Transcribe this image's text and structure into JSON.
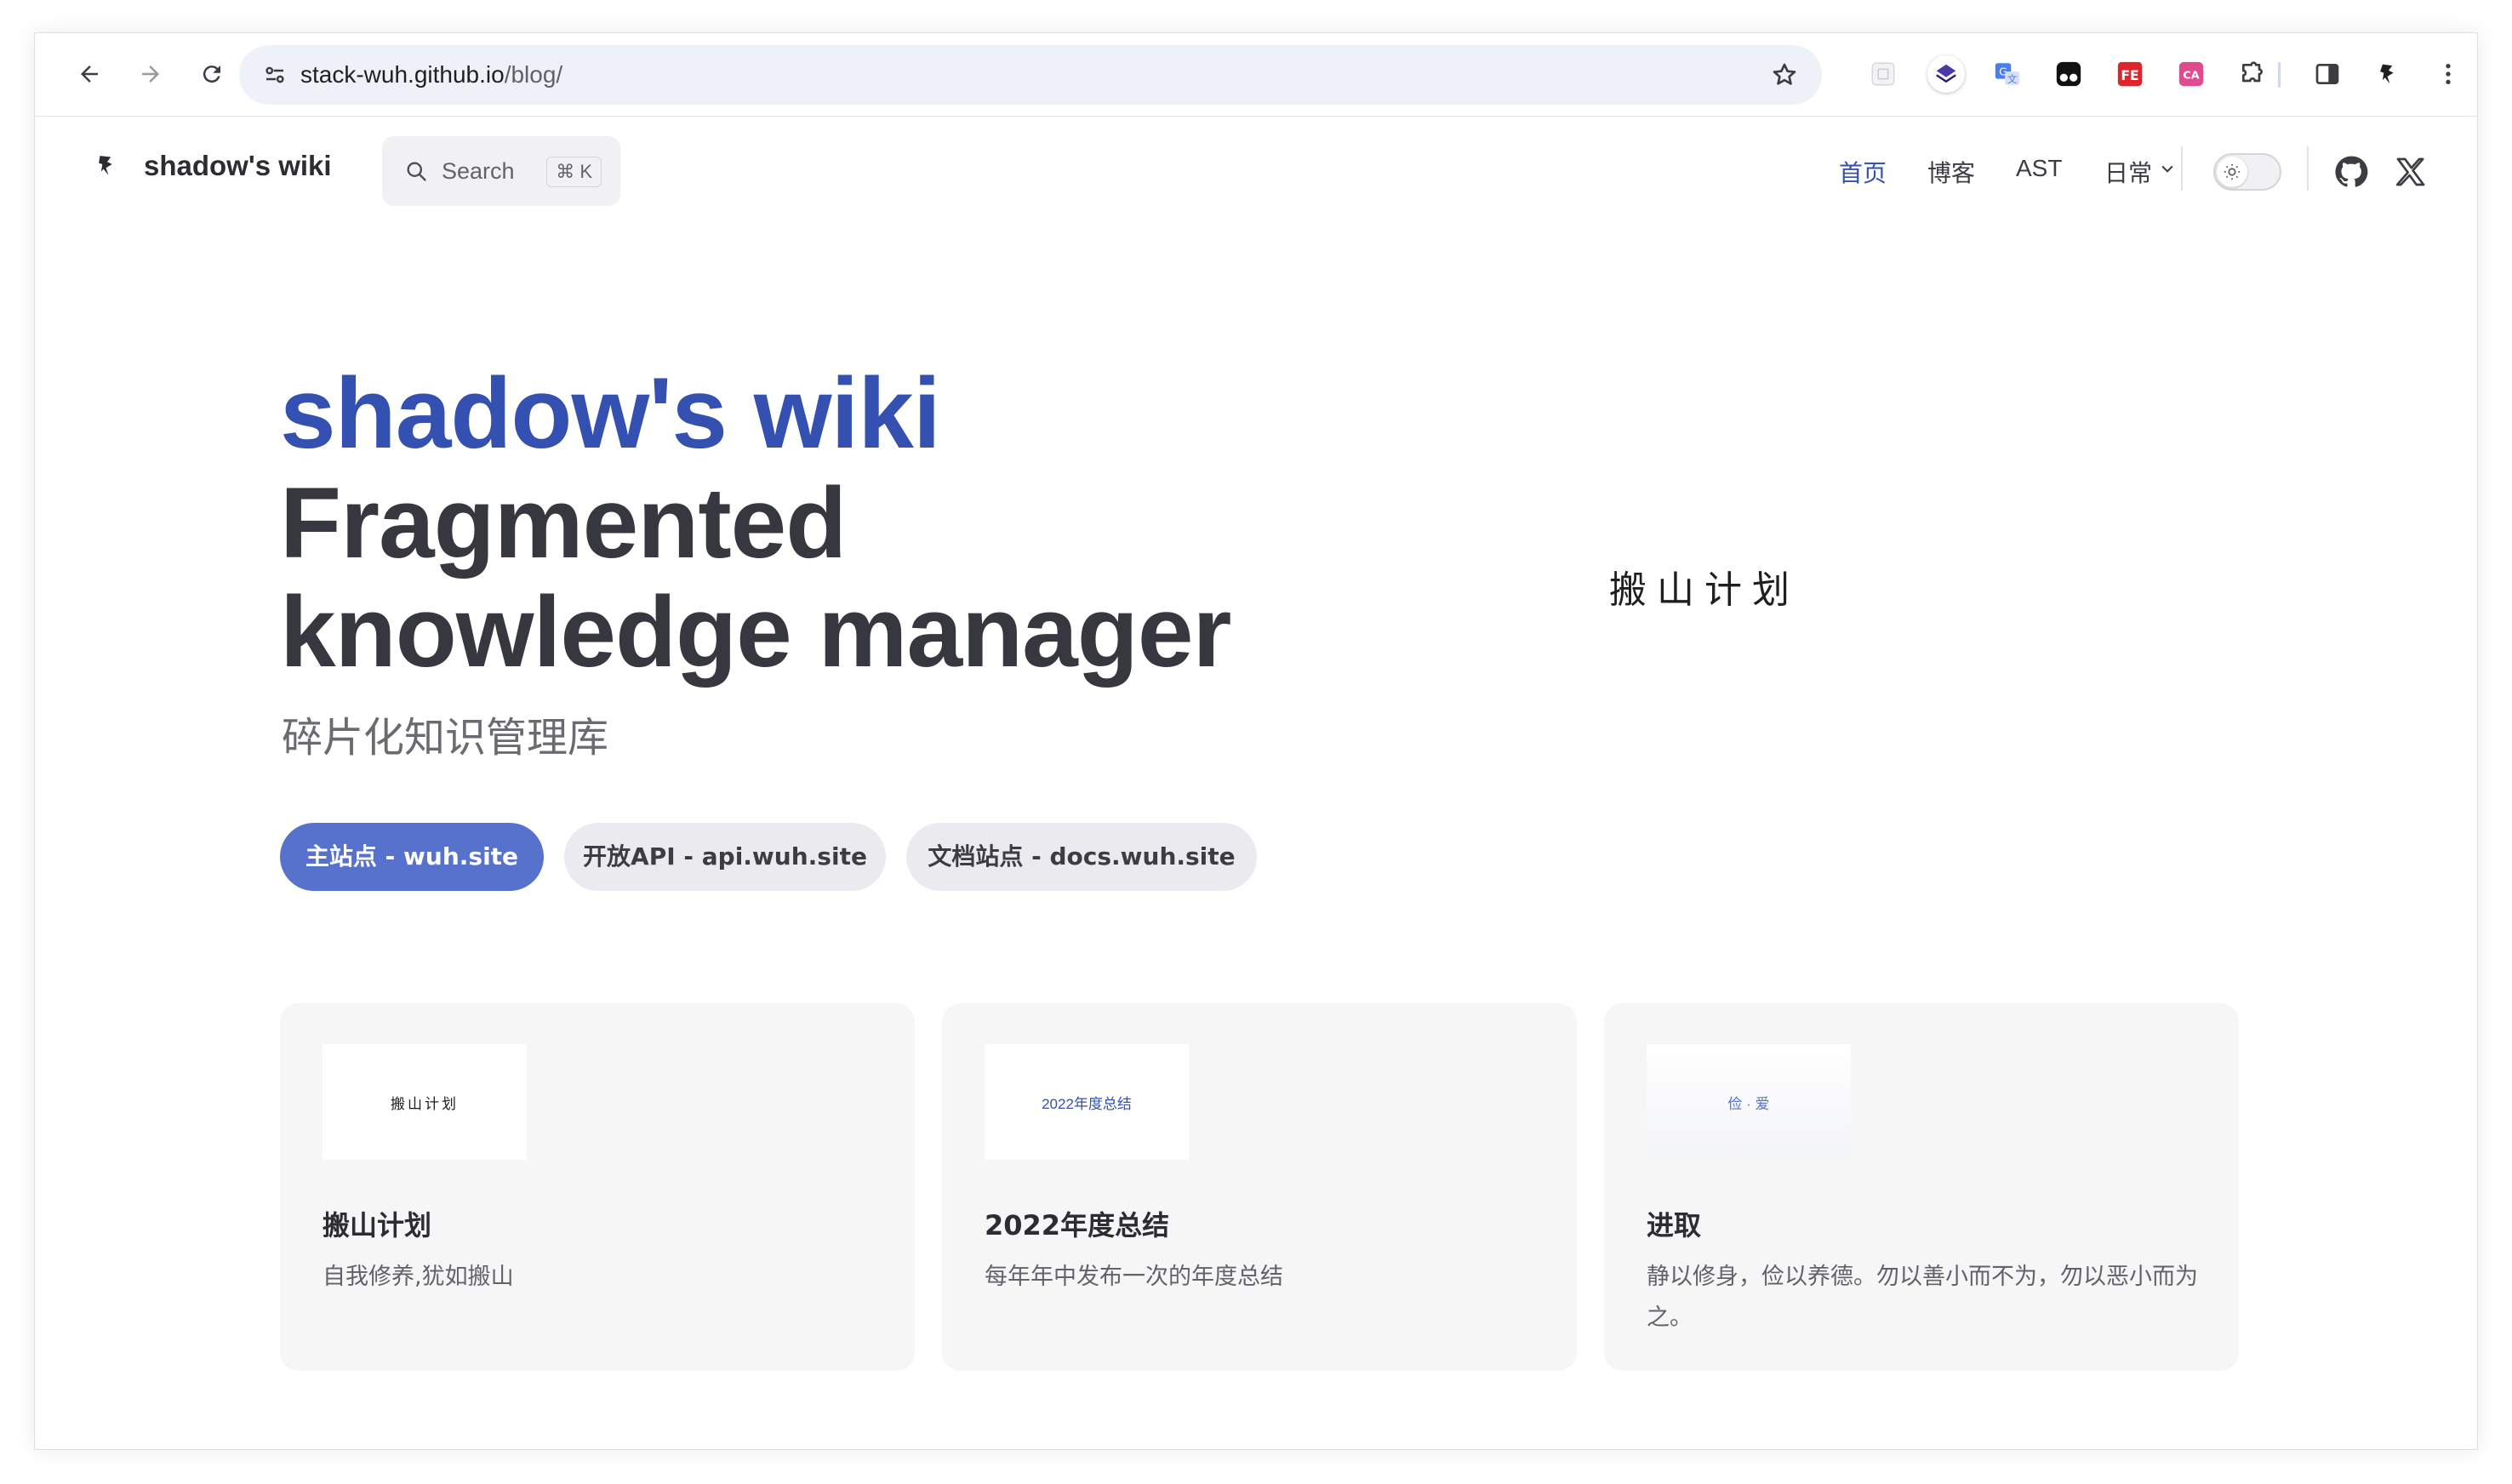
{
  "browser": {
    "url_host": "stack-wuh.github.io",
    "url_path": "/blog/",
    "extensions": [
      "grid-extension-icon",
      "layers-extension-icon",
      "translate-extension-icon",
      "tampermonkey-extension-icon",
      "fe-helper-extension-icon",
      "translate-ca-extension-icon",
      "puzzle-extensions-icon"
    ]
  },
  "site": {
    "name": "shadow's wiki",
    "search": {
      "label": "Search",
      "shortcut": "⌘ K"
    },
    "nav": [
      {
        "label": "首页",
        "active": true
      },
      {
        "label": "博客"
      },
      {
        "label": "AST"
      },
      {
        "label": "日常"
      }
    ]
  },
  "hero": {
    "name": "shadow's wiki",
    "text_line1": "Fragmented",
    "text_line2": "knowledge manager",
    "tagline": "碎片化知识管理库",
    "image_text": "搬山计划",
    "actions": [
      {
        "label": "主站点 - wuh.site",
        "theme": "brand"
      },
      {
        "label": "开放API - api.wuh.site",
        "theme": "alt"
      },
      {
        "label": "文档站点 - docs.wuh.site",
        "theme": "alt"
      }
    ]
  },
  "features": [
    {
      "image_text": "搬山计划",
      "title": "搬山计划",
      "details": "自我修养,犹如搬山"
    },
    {
      "image_text": "2022年度总结",
      "title": "2022年度总结",
      "details": "每年年中发布一次的年度总结"
    },
    {
      "image_text": "俭 · 爱",
      "title": "进取",
      "details": "静以修身，俭以养德。勿以善小而不为，勿以恶小而为之。"
    }
  ],
  "colors": {
    "brand": "#3451b2",
    "button_brand": "#5672cd"
  }
}
